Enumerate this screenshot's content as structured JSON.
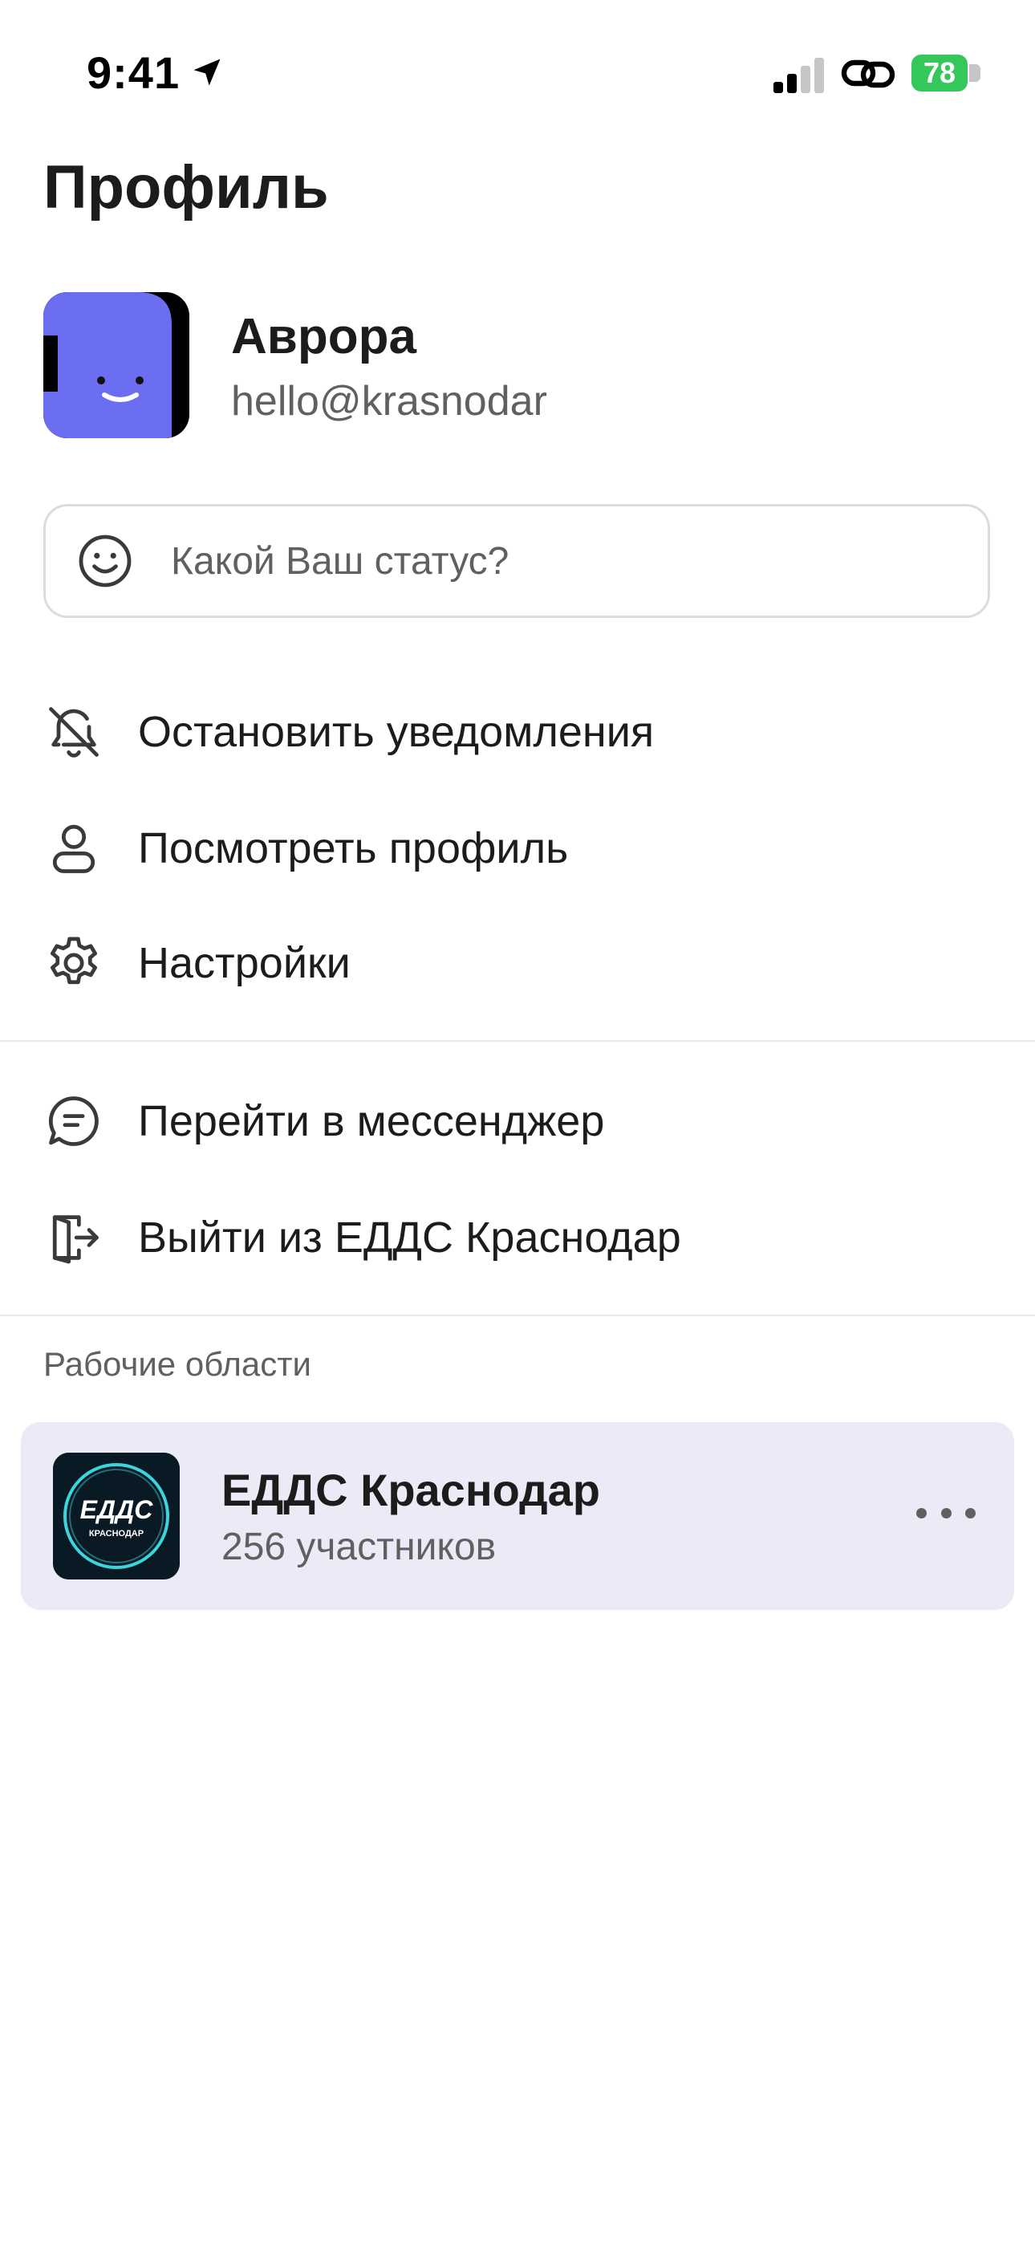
{
  "status_bar": {
    "time": "9:41",
    "battery": "78",
    "icons": [
      "location-arrow-icon",
      "cellular-signal-icon",
      "link-icon",
      "battery-charging-icon"
    ]
  },
  "page": {
    "title": "Профиль"
  },
  "profile": {
    "name": "Аврора",
    "email": "hello@krasnodar",
    "avatar_color": "#6b6ef0"
  },
  "status_input": {
    "placeholder": "Какой Ваш статус?",
    "value": "",
    "icon": "smiley-icon"
  },
  "menu": {
    "group1": [
      {
        "label": "Остановить уведомления",
        "icon": "bell-off-icon"
      },
      {
        "label": "Посмотреть профиль",
        "icon": "user-icon"
      },
      {
        "label": "Настройки",
        "icon": "gear-icon"
      }
    ],
    "group2": [
      {
        "label": "Перейти в мессенджер",
        "icon": "chat-bubble-icon"
      },
      {
        "label": "Выйти из ЕДДС Краснодар",
        "icon": "sign-out-door-icon"
      }
    ]
  },
  "workspaces": {
    "section_label": "Рабочие области",
    "items": [
      {
        "name": "ЕДДС Краснодар",
        "members": "256 участников",
        "logo_text": "ЕДДС",
        "logo_subtext": "КРАСНОДАР",
        "logo_ring_color": "#3ad6e0",
        "card_color": "#ebebf7"
      }
    ]
  },
  "colors": {
    "text_primary": "#1d1c1d",
    "text_secondary": "#616061",
    "battery_green": "#34c759"
  }
}
